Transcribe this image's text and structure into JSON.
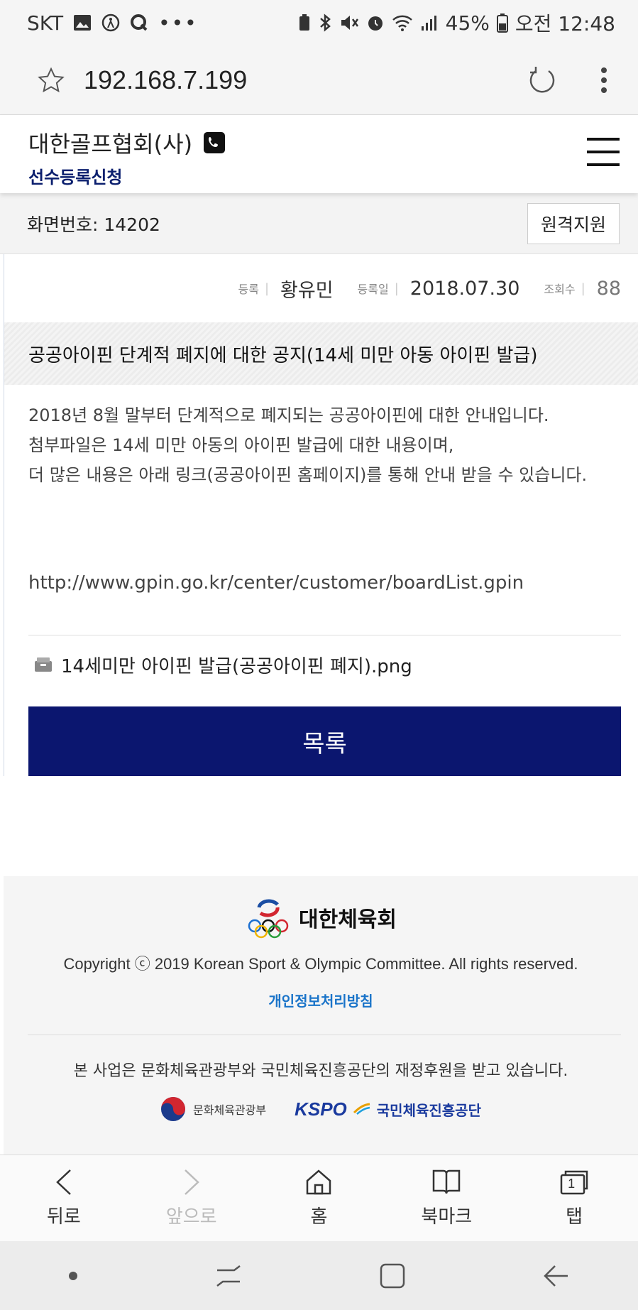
{
  "status_bar": {
    "carrier": "SKT",
    "battery": "45%",
    "time": "오전 12:48",
    "left_icons": [
      "image-icon",
      "accessibility-icon",
      "q-icon",
      "more-dots-icon"
    ],
    "right_icons": [
      "battery-saver-icon",
      "bluetooth-icon",
      "mute-icon",
      "alarm-icon",
      "wifi-icon",
      "signal-icon",
      "battery-icon"
    ]
  },
  "browser": {
    "url": "192.168.7.199"
  },
  "site": {
    "title": "대한골프협회(사)",
    "subtitle": "선수등록신청"
  },
  "screen_bar": {
    "screen_number": "화면번호: 14202",
    "remote_label": "원격지원"
  },
  "post": {
    "author_label": "등록",
    "author": "황유민",
    "date_label": "등록일",
    "date": "2018.07.30",
    "views_label": "조회수",
    "views": "88",
    "title": "공공아이핀 단계적 폐지에 대한 공지(14세 미만 아동 아이핀 발급)",
    "body_lines": [
      "2018년 8월 말부터 단계적으로 폐지되는 공공아이핀에 대한 안내입니다.",
      "첨부파일은 14세 미만 아동의 아이핀 발급에 대한 내용이며,",
      "더 많은 내용은 아래 링크(공공아이핀 홈페이지)를 통해 안내 받을 수 있습니다."
    ],
    "link": "http://www.gpin.go.kr/center/customer/boardList.gpin",
    "attachment": "14세미만 아이핀 발급(공공아이핀 폐지).png",
    "list_button": "목록"
  },
  "footer": {
    "org_name": "대한체육회",
    "copyright": "Copyright ⓒ 2019 Korean Sport & Olympic Committee. All rights reserved.",
    "privacy": "개인정보처리방침",
    "support_text": "본 사업은 문화체육관광부와 국민체육진흥공단의 재정후원을 받고 있습니다.",
    "sponsor1": "문화체육관광부",
    "sponsor2_logo": "KSPO",
    "sponsor2": "국민체육진흥공단"
  },
  "bottom_nav": {
    "back": "뒤로",
    "forward": "앞으로",
    "home": "홈",
    "bookmark": "북마크",
    "tabs": "탭",
    "tab_count": "1"
  },
  "colors": {
    "brand_navy": "#0b166f",
    "subtitle_navy": "#0b1f6e",
    "link_blue": "#1a74c9"
  }
}
